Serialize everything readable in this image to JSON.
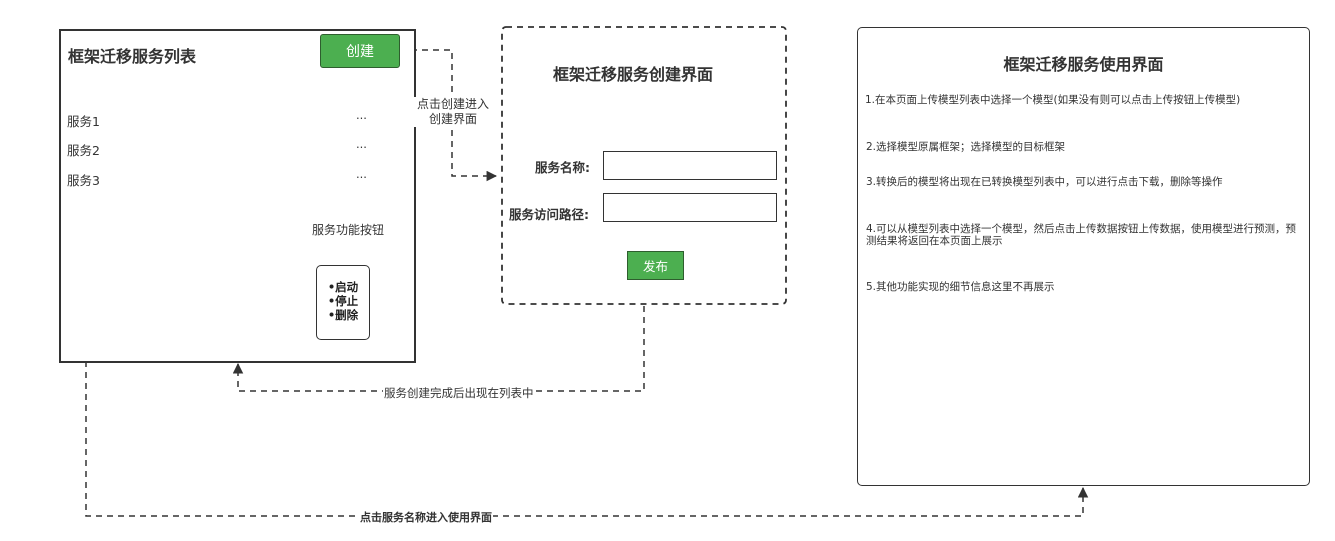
{
  "list_panel": {
    "title": "框架迁移服务列表",
    "create_label": "创建",
    "services": [
      {
        "name": "服务1",
        "more": "..."
      },
      {
        "name": "服务2",
        "more": "..."
      },
      {
        "name": "服务3",
        "more": "..."
      }
    ],
    "func_button_label": "服务功能按钮",
    "menu_items": [
      "•启动",
      "•停止",
      "•删除"
    ]
  },
  "create_panel": {
    "title": "框架迁移服务创建界面",
    "name_label": "服务名称:",
    "path_label": "服务访问路径:",
    "publish_label": "发布"
  },
  "usage_panel": {
    "title": "框架迁移服务使用界面",
    "steps": [
      "1.在本页面上传模型列表中选择一个模型(如果没有则可以点击上传按钮上传模型)",
      "2.选择模型原属框架；选择模型的目标框架",
      "3.转换后的模型将出现在已转换模型列表中，可以进行点击下载，删除等操作",
      "4.可以从模型列表中选择一个模型，然后点击上传数据按钮上传数据，使用模型进行预测，预测结果将返回在本页面上展示",
      "5.其他功能实现的细节信息这里不再展示"
    ]
  },
  "edges": {
    "create_to_form": "点击创建进入创建界面",
    "publish_to_list": "服务创建完成后出现在列表中",
    "name_to_usage": "点击服务名称进入使用界面"
  }
}
